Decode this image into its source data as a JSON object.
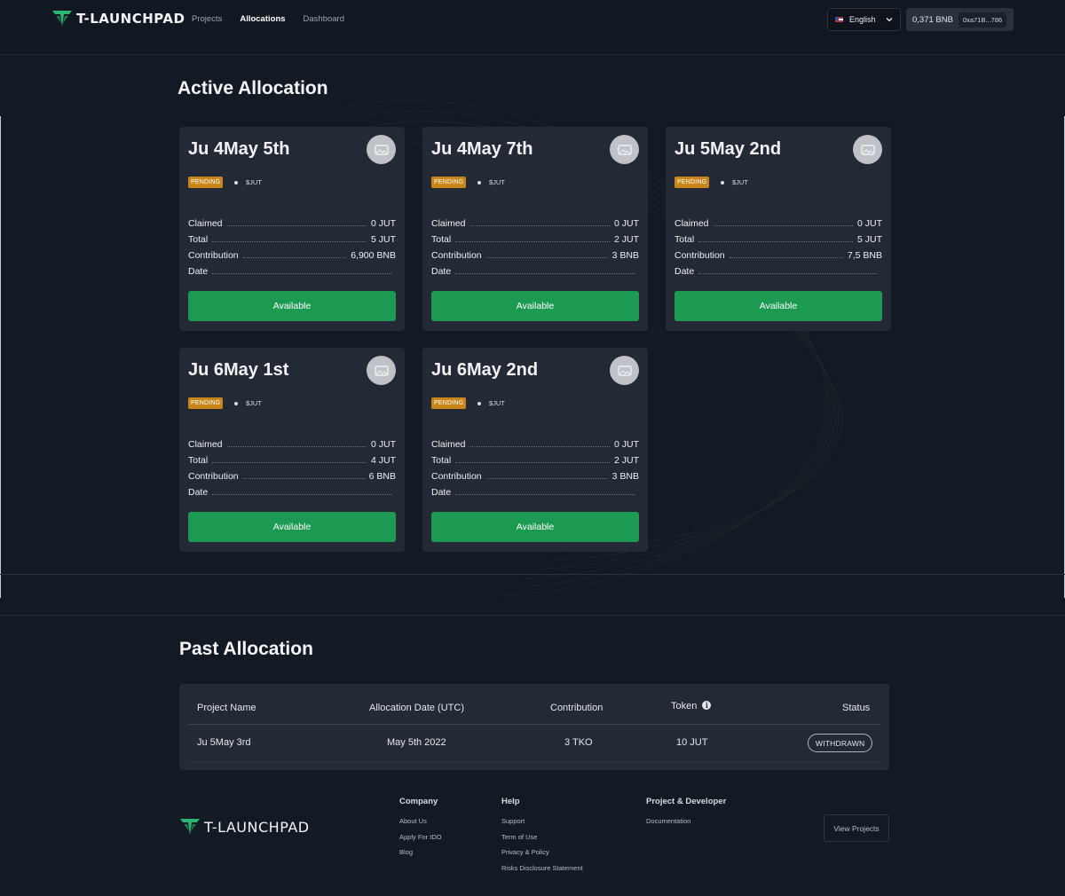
{
  "header": {
    "brand": "T-LAUNCHPAD",
    "nav": [
      {
        "label": "Projects",
        "active": false
      },
      {
        "label": "Allocations",
        "active": true
      },
      {
        "label": "Dashboard",
        "active": false
      }
    ],
    "language": "English",
    "wallet_balance": "0,371 BNB",
    "wallet_address": "0xa71B...786"
  },
  "active": {
    "title": "Active Allocation",
    "cards": [
      {
        "title": "Ju 4May 5th",
        "status": "PENDING",
        "token": "$JUT",
        "claimed_label": "Claimed",
        "claimed": "0 JUT",
        "total_label": "Total",
        "total": "5 JUT",
        "contribution_label": "Contribution",
        "contribution": "6,900 BNB",
        "date_label": "Date",
        "date": "",
        "button": "Available"
      },
      {
        "title": "Ju 4May 7th",
        "status": "PENDING",
        "token": "$JUT",
        "claimed_label": "Claimed",
        "claimed": "0 JUT",
        "total_label": "Total",
        "total": "2 JUT",
        "contribution_label": "Contribution",
        "contribution": "3 BNB",
        "date_label": "Date",
        "date": "",
        "button": "Available"
      },
      {
        "title": "Ju 5May 2nd",
        "status": "PENDING",
        "token": "$JUT",
        "claimed_label": "Claimed",
        "claimed": "0 JUT",
        "total_label": "Total",
        "total": "5 JUT",
        "contribution_label": "Contribution",
        "contribution": "7,5 BNB",
        "date_label": "Date",
        "date": "",
        "button": "Available"
      },
      {
        "title": "Ju 6May 1st",
        "status": "PENDING",
        "token": "$JUT",
        "claimed_label": "Claimed",
        "claimed": "0 JUT",
        "total_label": "Total",
        "total": "4 JUT",
        "contribution_label": "Contribution",
        "contribution": "6 BNB",
        "date_label": "Date",
        "date": "",
        "button": "Available"
      },
      {
        "title": "Ju 6May 2nd",
        "status": "PENDING",
        "token": "$JUT",
        "claimed_label": "Claimed",
        "claimed": "0 JUT",
        "total_label": "Total",
        "total": "2 JUT",
        "contribution_label": "Contribution",
        "contribution": "3 BNB",
        "date_label": "Date",
        "date": "",
        "button": "Available"
      }
    ]
  },
  "past": {
    "title": "Past Allocation",
    "columns": {
      "project": "Project Name",
      "date": "Allocation Date (UTC)",
      "contribution": "Contribution",
      "token": "Token",
      "status": "Status"
    },
    "rows": [
      {
        "project": "Ju 5May 3rd",
        "date": "May 5th 2022",
        "contribution": "3 TKO",
        "token": "10 JUT",
        "status": "WITHDRAWN"
      }
    ]
  },
  "footer": {
    "brand": "T-LAUNCHPAD",
    "company": {
      "heading": "Company",
      "links": [
        "About Us",
        "Apply For IDO",
        "Blog"
      ]
    },
    "help": {
      "heading": "Help",
      "links": [
        "Support",
        "Term of Use",
        "Privacy & Policy",
        "Risks Disclosure Statement"
      ]
    },
    "developer": {
      "heading": "Project & Developer",
      "links": [
        "Documentation"
      ]
    },
    "view_projects": "View Projects"
  },
  "colors": {
    "background": "#141a24",
    "card": "#232a35",
    "accent_green": "#1c9a52",
    "pending": "#c9861a"
  }
}
